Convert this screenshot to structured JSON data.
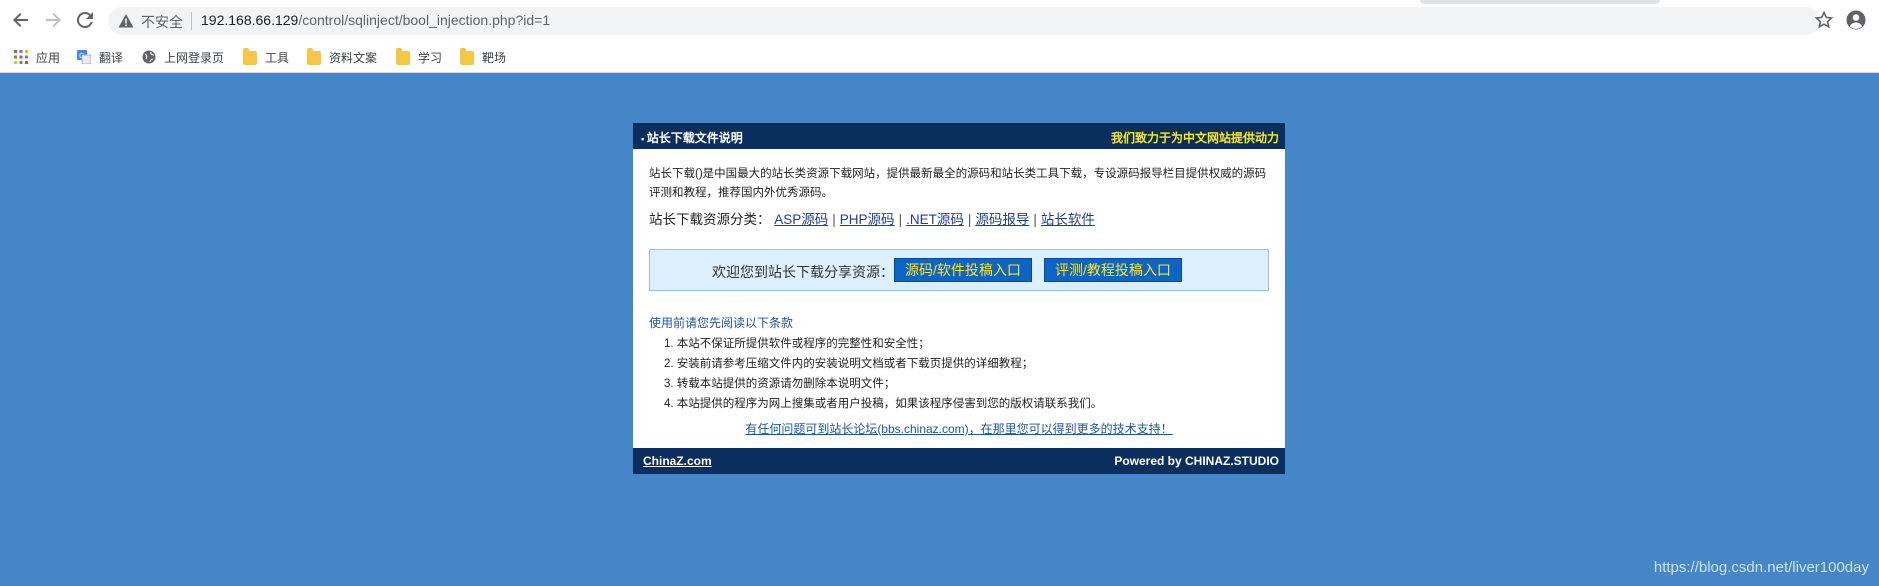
{
  "browser": {
    "security_label": "不安全",
    "url_host": "192.168.66.129",
    "url_path": "/control/sqlinject/bool_injection.php?id=1",
    "bookmarks": [
      {
        "label": "应用",
        "icon": "apps-grid-icon"
      },
      {
        "label": "翻译",
        "icon": "translate-icon"
      },
      {
        "label": "上网登录页",
        "icon": "globe-icon"
      },
      {
        "label": "工具",
        "icon": "folder-icon"
      },
      {
        "label": "资料文案",
        "icon": "folder-icon"
      },
      {
        "label": "学习",
        "icon": "folder-icon"
      },
      {
        "label": "靶场",
        "icon": "folder-icon"
      }
    ]
  },
  "page": {
    "background": "#4486c8",
    "header": {
      "title": "站长下载文件说明",
      "slogan": "我们致力于为中文网站提供动力"
    },
    "intro": "站长下载()是中国最大的站长类资源下载网站，提供最新最全的源码和站长类工具下载，专设源码报导栏目提供权威的源码评测和教程，推荐国内外优秀源码。",
    "categories": {
      "label": "站长下载资源分类：",
      "links": [
        "ASP源码",
        "PHP源码",
        ".NET源码",
        "源码报导",
        "站长软件"
      ],
      "separator": "|"
    },
    "share": {
      "label": "欢迎您到站长下载分享资源：",
      "button1": "源码/软件投稿入口",
      "button2": "评测/教程投稿入口"
    },
    "terms": {
      "title": "使用前请您先阅读以下条款",
      "items": [
        "1. 本站不保证所提供软件或程序的完整性和安全性；",
        "2. 安装前请参考压缩文件内的安装说明文档或者下载页提供的详细教程；",
        "3. 转载本站提供的资源请勿删除本说明文件；",
        "4. 本站提供的程序为网上搜集或者用户投稿，如果该程序侵害到您的版权请联系我们。"
      ]
    },
    "help_link": "有任何问题可到站长论坛(bbs.chinaz.com)，在那里您可以得到更多的技术支持！",
    "footer": {
      "left": "ChinaZ.com",
      "right": "Powered by CHINAZ.STUDIO"
    }
  },
  "watermark": "https://blog.csdn.net/liver100day"
}
